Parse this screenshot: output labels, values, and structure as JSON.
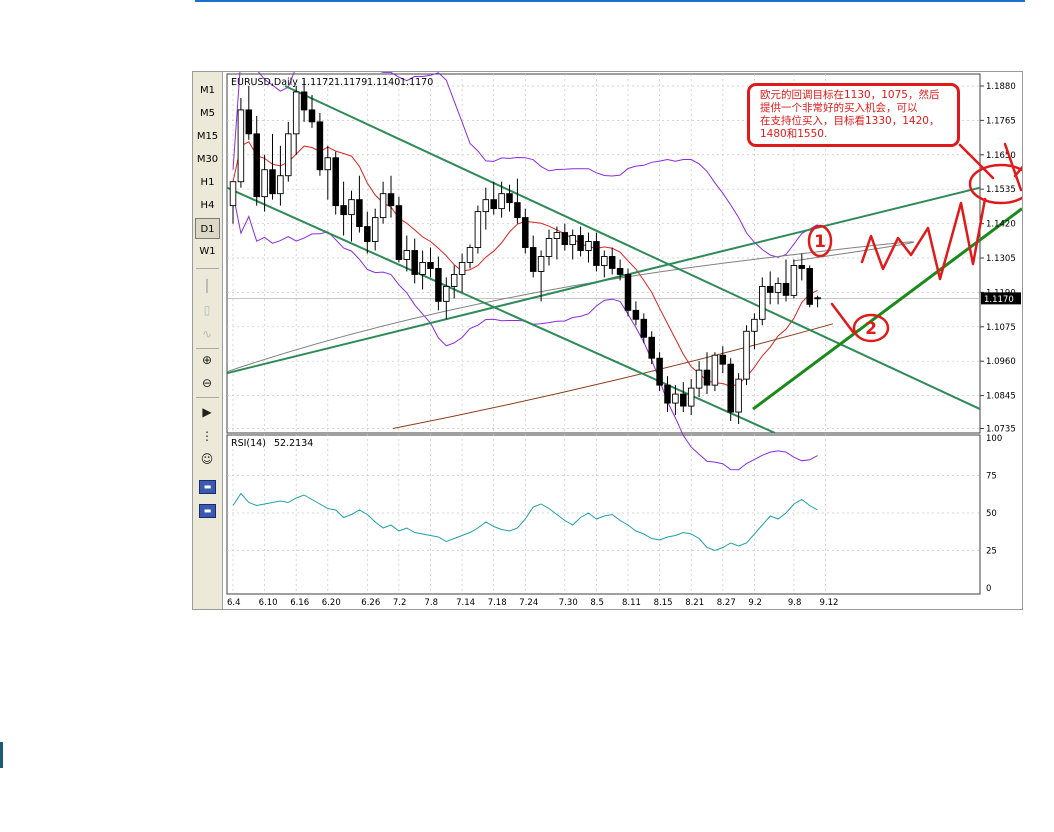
{
  "chart_data": {
    "type": "candlestick",
    "header": {
      "symbol": "EURUSD,Daily",
      "open": "1.1172",
      "high": "1.1179",
      "low": "1.1140",
      "close": "1.1170"
    },
    "price_axis_labels": [
      "1.1880",
      "1.1765",
      "1.1650",
      "1.1535",
      "1.1420",
      "1.1305",
      "1.1190",
      "1.1075",
      "1.0960",
      "1.0845",
      "1.0735"
    ],
    "price_range": [
      1.073,
      1.191
    ],
    "current_price_label": "1.1170",
    "date_labels": [
      "6.4",
      "6.10",
      "6.16",
      "6.20",
      "6.26",
      "7.2",
      "7.8",
      "7.14",
      "7.18",
      "7.24",
      "7.30",
      "8.5",
      "8.11",
      "8.15",
      "8.21",
      "8.27",
      "9.2",
      "9.8",
      "9.12"
    ],
    "candles": [
      {
        "o": 1.148,
        "h": 1.156,
        "l": 1.142,
        "c": 1.156
      },
      {
        "o": 1.156,
        "h": 1.184,
        "l": 1.154,
        "c": 1.18
      },
      {
        "o": 1.18,
        "h": 1.188,
        "l": 1.17,
        "c": 1.172
      },
      {
        "o": 1.172,
        "h": 1.178,
        "l": 1.148,
        "c": 1.151
      },
      {
        "o": 1.151,
        "h": 1.165,
        "l": 1.146,
        "c": 1.16
      },
      {
        "o": 1.16,
        "h": 1.172,
        "l": 1.15,
        "c": 1.152
      },
      {
        "o": 1.152,
        "h": 1.168,
        "l": 1.148,
        "c": 1.158
      },
      {
        "o": 1.158,
        "h": 1.176,
        "l": 1.156,
        "c": 1.172
      },
      {
        "o": 1.172,
        "h": 1.188,
        "l": 1.165,
        "c": 1.186
      },
      {
        "o": 1.186,
        "h": 1.19,
        "l": 1.176,
        "c": 1.18
      },
      {
        "o": 1.18,
        "h": 1.185,
        "l": 1.174,
        "c": 1.176
      },
      {
        "o": 1.176,
        "h": 1.179,
        "l": 1.158,
        "c": 1.16
      },
      {
        "o": 1.16,
        "h": 1.168,
        "l": 1.15,
        "c": 1.164
      },
      {
        "o": 1.164,
        "h": 1.166,
        "l": 1.145,
        "c": 1.148
      },
      {
        "o": 1.148,
        "h": 1.156,
        "l": 1.138,
        "c": 1.145
      },
      {
        "o": 1.145,
        "h": 1.153,
        "l": 1.136,
        "c": 1.15
      },
      {
        "o": 1.15,
        "h": 1.158,
        "l": 1.139,
        "c": 1.141
      },
      {
        "o": 1.141,
        "h": 1.146,
        "l": 1.132,
        "c": 1.136
      },
      {
        "o": 1.136,
        "h": 1.147,
        "l": 1.133,
        "c": 1.144
      },
      {
        "o": 1.144,
        "h": 1.156,
        "l": 1.142,
        "c": 1.152
      },
      {
        "o": 1.152,
        "h": 1.158,
        "l": 1.144,
        "c": 1.148
      },
      {
        "o": 1.148,
        "h": 1.151,
        "l": 1.129,
        "c": 1.13
      },
      {
        "o": 1.13,
        "h": 1.138,
        "l": 1.126,
        "c": 1.133
      },
      {
        "o": 1.133,
        "h": 1.137,
        "l": 1.122,
        "c": 1.125
      },
      {
        "o": 1.125,
        "h": 1.133,
        "l": 1.12,
        "c": 1.129
      },
      {
        "o": 1.129,
        "h": 1.134,
        "l": 1.124,
        "c": 1.127
      },
      {
        "o": 1.127,
        "h": 1.131,
        "l": 1.113,
        "c": 1.116
      },
      {
        "o": 1.116,
        "h": 1.124,
        "l": 1.11,
        "c": 1.121
      },
      {
        "o": 1.121,
        "h": 1.128,
        "l": 1.117,
        "c": 1.125
      },
      {
        "o": 1.125,
        "h": 1.132,
        "l": 1.119,
        "c": 1.129
      },
      {
        "o": 1.129,
        "h": 1.135,
        "l": 1.127,
        "c": 1.134
      },
      {
        "o": 1.134,
        "h": 1.148,
        "l": 1.132,
        "c": 1.146
      },
      {
        "o": 1.146,
        "h": 1.154,
        "l": 1.14,
        "c": 1.15
      },
      {
        "o": 1.15,
        "h": 1.156,
        "l": 1.145,
        "c": 1.147
      },
      {
        "o": 1.147,
        "h": 1.156,
        "l": 1.144,
        "c": 1.152
      },
      {
        "o": 1.152,
        "h": 1.155,
        "l": 1.146,
        "c": 1.149
      },
      {
        "o": 1.149,
        "h": 1.157,
        "l": 1.142,
        "c": 1.144
      },
      {
        "o": 1.144,
        "h": 1.147,
        "l": 1.132,
        "c": 1.134
      },
      {
        "o": 1.134,
        "h": 1.138,
        "l": 1.124,
        "c": 1.126
      },
      {
        "o": 1.126,
        "h": 1.133,
        "l": 1.116,
        "c": 1.131
      },
      {
        "o": 1.131,
        "h": 1.14,
        "l": 1.128,
        "c": 1.137
      },
      {
        "o": 1.137,
        "h": 1.141,
        "l": 1.13,
        "c": 1.139
      },
      {
        "o": 1.139,
        "h": 1.142,
        "l": 1.133,
        "c": 1.135
      },
      {
        "o": 1.135,
        "h": 1.14,
        "l": 1.13,
        "c": 1.138
      },
      {
        "o": 1.138,
        "h": 1.141,
        "l": 1.131,
        "c": 1.133
      },
      {
        "o": 1.133,
        "h": 1.139,
        "l": 1.129,
        "c": 1.136
      },
      {
        "o": 1.136,
        "h": 1.139,
        "l": 1.126,
        "c": 1.128
      },
      {
        "o": 1.128,
        "h": 1.133,
        "l": 1.124,
        "c": 1.131
      },
      {
        "o": 1.131,
        "h": 1.134,
        "l": 1.125,
        "c": 1.127
      },
      {
        "o": 1.127,
        "h": 1.13,
        "l": 1.123,
        "c": 1.125
      },
      {
        "o": 1.125,
        "h": 1.127,
        "l": 1.111,
        "c": 1.113
      },
      {
        "o": 1.113,
        "h": 1.116,
        "l": 1.108,
        "c": 1.11
      },
      {
        "o": 1.11,
        "h": 1.112,
        "l": 1.102,
        "c": 1.104
      },
      {
        "o": 1.104,
        "h": 1.106,
        "l": 1.095,
        "c": 1.097
      },
      {
        "o": 1.097,
        "h": 1.099,
        "l": 1.086,
        "c": 1.088
      },
      {
        "o": 1.088,
        "h": 1.091,
        "l": 1.079,
        "c": 1.082
      },
      {
        "o": 1.082,
        "h": 1.088,
        "l": 1.078,
        "c": 1.085
      },
      {
        "o": 1.085,
        "h": 1.089,
        "l": 1.079,
        "c": 1.081
      },
      {
        "o": 1.081,
        "h": 1.09,
        "l": 1.078,
        "c": 1.087
      },
      {
        "o": 1.087,
        "h": 1.096,
        "l": 1.084,
        "c": 1.093
      },
      {
        "o": 1.093,
        "h": 1.099,
        "l": 1.085,
        "c": 1.088
      },
      {
        "o": 1.088,
        "h": 1.099,
        "l": 1.086,
        "c": 1.098
      },
      {
        "o": 1.098,
        "h": 1.101,
        "l": 1.092,
        "c": 1.095
      },
      {
        "o": 1.095,
        "h": 1.097,
        "l": 1.076,
        "c": 1.079
      },
      {
        "o": 1.079,
        "h": 1.092,
        "l": 1.075,
        "c": 1.09
      },
      {
        "o": 1.09,
        "h": 1.108,
        "l": 1.088,
        "c": 1.106
      },
      {
        "o": 1.106,
        "h": 1.112,
        "l": 1.1,
        "c": 1.11
      },
      {
        "o": 1.11,
        "h": 1.124,
        "l": 1.108,
        "c": 1.121
      },
      {
        "o": 1.121,
        "h": 1.126,
        "l": 1.115,
        "c": 1.119
      },
      {
        "o": 1.119,
        "h": 1.124,
        "l": 1.115,
        "c": 1.122
      },
      {
        "o": 1.122,
        "h": 1.13,
        "l": 1.116,
        "c": 1.118
      },
      {
        "o": 1.118,
        "h": 1.13,
        "l": 1.117,
        "c": 1.128
      },
      {
        "o": 1.128,
        "h": 1.132,
        "l": 1.123,
        "c": 1.127
      },
      {
        "o": 1.127,
        "h": 1.128,
        "l": 1.114,
        "c": 1.115
      },
      {
        "o": 1.1172,
        "h": 1.1179,
        "l": 1.114,
        "c": 1.117
      }
    ],
    "rsi": {
      "label": "RSI(14)",
      "value": "52.2134",
      "axis_labels": [
        "100",
        "75",
        "50",
        "25",
        "0"
      ],
      "values": [
        55,
        63,
        57,
        55,
        56,
        57,
        58,
        57,
        60,
        62,
        59,
        56,
        53,
        52,
        47,
        49,
        52,
        49,
        44,
        40,
        42,
        38,
        40,
        37,
        36,
        35,
        34,
        31,
        33,
        35,
        37,
        40,
        44,
        41,
        39,
        38,
        40,
        46,
        54,
        56,
        53,
        49,
        45,
        42,
        47,
        50,
        46,
        48,
        49,
        45,
        42,
        38,
        36,
        33,
        32,
        34,
        35,
        37,
        36,
        33,
        27,
        25,
        27,
        30,
        28,
        30,
        36,
        42,
        48,
        46,
        50,
        56,
        59,
        55,
        52
      ]
    }
  },
  "timeframes": [
    "M1",
    "M5",
    "M15",
    "M30",
    "H1",
    "H4",
    "D1",
    "W1"
  ],
  "active_timeframe": "D1",
  "annotation": {
    "lines": [
      "欧元的回调目标在1130，1075，然后",
      "提供一个非常好的买入机会，可以",
      "在支持位买入，目标看1330，1420，",
      "1480和1550."
    ],
    "marker_1": "1",
    "marker_2": "2"
  },
  "colors": {
    "bull_candle": "#ffffff",
    "bear_candle": "#000000",
    "channel_line": "#2e8b57",
    "bollinger": "#8a2be2",
    "ma_fast": "#dd2222",
    "ma_mid": "#8b3a1a",
    "ma_slow": "#808080",
    "rsi_line": "#20a0a8",
    "annotation": "#e01a1a"
  }
}
